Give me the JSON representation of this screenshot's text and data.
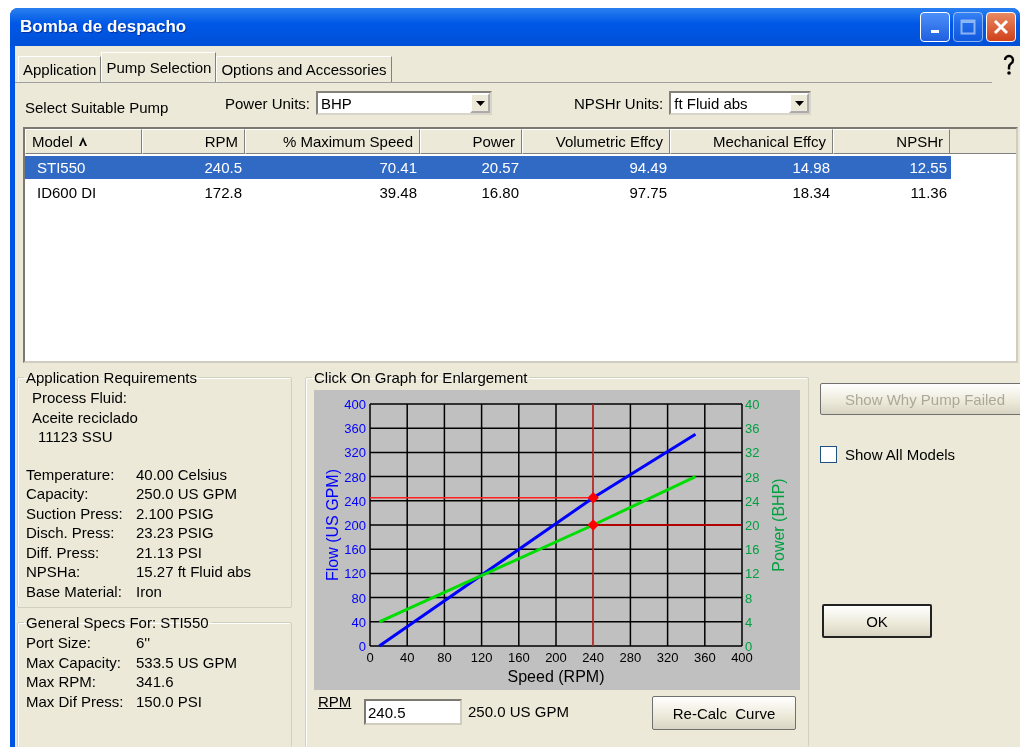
{
  "window": {
    "title": "Bomba de despacho"
  },
  "tabs": [
    {
      "label": "Application",
      "selected": false
    },
    {
      "label": "Pump Selection",
      "selected": true
    },
    {
      "label": "Options and Accessories",
      "selected": false
    }
  ],
  "select_label": "Select Suitable Pump",
  "power_units": {
    "label": "Power Units:",
    "value": "BHP"
  },
  "npshr_units": {
    "label": "NPSHr Units:",
    "value": "ft Fluid abs"
  },
  "table": {
    "columns": [
      {
        "label": "Model",
        "sorted": true
      },
      {
        "label": "RPM",
        "sorted": false
      },
      {
        "label": "% Maximum Speed",
        "sorted": false
      },
      {
        "label": "Power",
        "sorted": false
      },
      {
        "label": "Volumetric Effcy",
        "sorted": false
      },
      {
        "label": "Mechanical Effcy",
        "sorted": false
      },
      {
        "label": "NPSHr",
        "sorted": false
      }
    ],
    "rows": [
      {
        "selected": true,
        "cells": [
          "STI550",
          "240.5",
          "70.41",
          "20.57",
          "94.49",
          "14.98",
          "12.55"
        ]
      },
      {
        "selected": false,
        "cells": [
          "ID600 DI",
          "172.8",
          "39.48",
          "16.80",
          "97.75",
          "18.34",
          "11.36"
        ]
      }
    ]
  },
  "application_requirements": {
    "title": "Application Requirements",
    "fluid_label": "Process Fluid:",
    "fluid_name": "Aceite reciclado",
    "viscosity": "11123 SSU",
    "fields": [
      {
        "label": "Temperature:",
        "value": "40.00 Celsius"
      },
      {
        "label": "Capacity:",
        "value": "250.0 US GPM"
      },
      {
        "label": "Suction Press:",
        "value": "2.100 PSIG"
      },
      {
        "label": "Disch. Press:",
        "value": "23.23 PSIG"
      },
      {
        "label": "Diff. Press:",
        "value": "21.13 PSI"
      },
      {
        "label": "NPSHa:",
        "value": "15.27 ft Fluid abs"
      },
      {
        "label": "Base Material:",
        "value": "Iron"
      }
    ]
  },
  "general_specs": {
    "title": "General Specs For: STI550",
    "fields": [
      {
        "label": "Port Size:",
        "value": "6''"
      },
      {
        "label": "Max Capacity:",
        "value": "533.5 US GPM"
      },
      {
        "label": "Max RPM:",
        "value": "341.6"
      },
      {
        "label": "Max Dif Press:",
        "value": "150.0 PSI"
      }
    ]
  },
  "graph": {
    "title": "Click On Graph for Enlargement",
    "chart_data": {
      "type": "line",
      "xlabel": "Speed (RPM)",
      "ylabel": "Flow (US GPM)",
      "y2label": "Power (BHP)",
      "x": [
        10,
        240,
        350
      ],
      "series": [
        {
          "color": "#0000ff",
          "values": [
            0,
            245,
            350
          ]
        },
        {
          "color": "#00dd00",
          "axis": "y2",
          "values": [
            4,
            20,
            28
          ]
        }
      ],
      "xlim": [
        0,
        400
      ],
      "ylim": [
        0,
        400
      ],
      "y2lim": [
        0,
        40
      ],
      "xticks": [
        0,
        40,
        80,
        120,
        160,
        200,
        240,
        280,
        320,
        360,
        400
      ],
      "yticks": [
        0,
        40,
        80,
        120,
        160,
        200,
        240,
        280,
        320,
        360,
        400
      ],
      "y2ticks": [
        0,
        4,
        8,
        12,
        16,
        20,
        24,
        28,
        32,
        36,
        40
      ],
      "grid": true,
      "ref_lines": [
        {
          "axis": "x",
          "value": 240,
          "color": "#ff2020"
        },
        {
          "axis": "y",
          "value": 245,
          "color": "#ff2020"
        },
        {
          "axis": "y2",
          "value": 20,
          "color": "#b00000"
        }
      ]
    },
    "rpm_label": "RPM",
    "rpm_value": "240.5",
    "flow_reading": "250.0 US GPM",
    "recalc_button": "Re-Calc  Curve"
  },
  "show_why_button": {
    "label": "Show Why Pump Failed",
    "disabled": true
  },
  "show_all_models": {
    "label": "Show All Models",
    "checked": false
  },
  "ok_button": "OK"
}
